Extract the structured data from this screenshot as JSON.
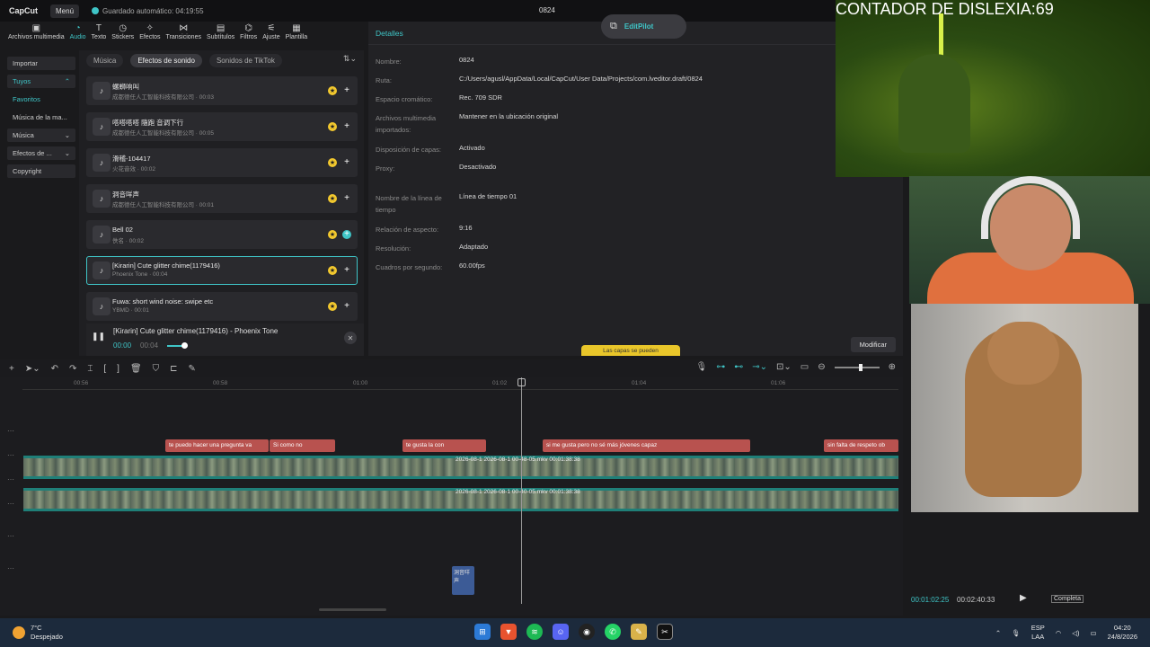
{
  "app": {
    "logo": "CapCut",
    "menu": "Menú",
    "autosave": "Guardado automático: 04:19:55",
    "project_name": "0824"
  },
  "tool_tabs": [
    {
      "label": "Archivos multimedia",
      "icon": "media-icon"
    },
    {
      "label": "Audio",
      "icon": "audio-icon",
      "active": true
    },
    {
      "label": "Texto",
      "icon": "text-icon"
    },
    {
      "label": "Stickers",
      "icon": "sticker-icon"
    },
    {
      "label": "Efectos",
      "icon": "effects-icon"
    },
    {
      "label": "Transiciones",
      "icon": "transitions-icon"
    },
    {
      "label": "Subtítulos",
      "icon": "subtitles-icon"
    },
    {
      "label": "Filtros",
      "icon": "filters-icon"
    },
    {
      "label": "Ajuste",
      "icon": "adjust-icon"
    },
    {
      "label": "Plantilla",
      "icon": "template-icon"
    }
  ],
  "left_nav": {
    "import": "Importar",
    "yours": "Tuyos",
    "favorites": "Favoritos",
    "music_library": "Música de la ma...",
    "music": "Música",
    "effects": "Efectos de ...",
    "copyright": "Copyright"
  },
  "subtabs": {
    "music": "Música",
    "sound_effects": "Efectos de sonido",
    "tiktok": "Sonidos de TikTok"
  },
  "sounds": [
    {
      "title": "螺蛳响叫",
      "meta": "成都德任人工智能科技有限公司 · 00:03"
    },
    {
      "title": "嗒嗒嗒嗒 隨跑 音调下行",
      "meta": "成都德任人工智能科技有限公司 · 00:05"
    },
    {
      "title": "滑稽-104417",
      "meta": "火花音效 · 00:02"
    },
    {
      "title": "洞音咩声",
      "meta": "成都德任人工智能科技有限公司 · 00:01"
    },
    {
      "title": "Bell 02",
      "meta": "佚名 · 00:02"
    },
    {
      "title": "[Kirarin] Cute glitter chime(1179416)",
      "meta": "Phoenix Tone · 00:04"
    },
    {
      "title": "Fuwa: short wind noise: swipe etc",
      "meta": "YBMD · 00:01"
    }
  ],
  "player": {
    "title": "[Kirarin] Cute glitter chime(1179416) - Phoenix Tone",
    "current": "00:00",
    "total": "00:04",
    "progress": 0.2
  },
  "details": {
    "header": "Detalles",
    "rows": [
      {
        "label": "Nombre:",
        "value": "0824"
      },
      {
        "label": "Ruta:",
        "value": "C:/Users/agusl/AppData/Local/CapCut/User Data/Projects/com.lveditor.draft/0824"
      },
      {
        "label": "Espacio cromático:",
        "value": "Rec. 709 SDR"
      },
      {
        "label": "Archivos multimedia importados:",
        "value": "Mantener en la ubicación original"
      },
      {
        "label": "Disposición de capas:",
        "value": "Activado"
      },
      {
        "label": "Proxy:",
        "value": "Desactivado"
      },
      {
        "label": "Nombre de la línea de tiempo",
        "value": "Línea de tiempo 01"
      },
      {
        "label": "Relación de aspecto:",
        "value": "9:16"
      },
      {
        "label": "Resolución:",
        "value": "Adaptado"
      },
      {
        "label": "Cuadros por segundo:",
        "value": "60.00fps"
      }
    ],
    "modify": "Modificar",
    "tooltip": "Las capas se pueden"
  },
  "editpilot": "EditPilot",
  "timeline": {
    "ruler": [
      "00:56",
      "00:58",
      "01:00",
      "01:02",
      "01:04",
      "01:06"
    ],
    "captions": [
      "te puedo hacer una pregunta  va",
      "Si como no",
      "te gusta la con",
      "si me gusta pero no sé más jóvenes capaz",
      "sin falta de respeto ob"
    ],
    "video_label_1": "2026-08-1  2026-08-1   00-48-05.mkv   00:01:38:38",
    "video_label_2": "2026-08-1  2026-08-1   00-40-05.mkv   00:01:38:38",
    "audio_clip": "洞音咩声"
  },
  "preview": {
    "current": "00:01:02:25",
    "total": "00:02:40:33",
    "full": "Completa"
  },
  "overlay": {
    "counter": "CONTADOR DE DISLEXIA:69"
  },
  "taskbar": {
    "temp": "7°C",
    "weather": "Despejado",
    "lang1": "ESP",
    "lang2": "LAA",
    "time": "04:20",
    "date": "24/8/2026"
  }
}
